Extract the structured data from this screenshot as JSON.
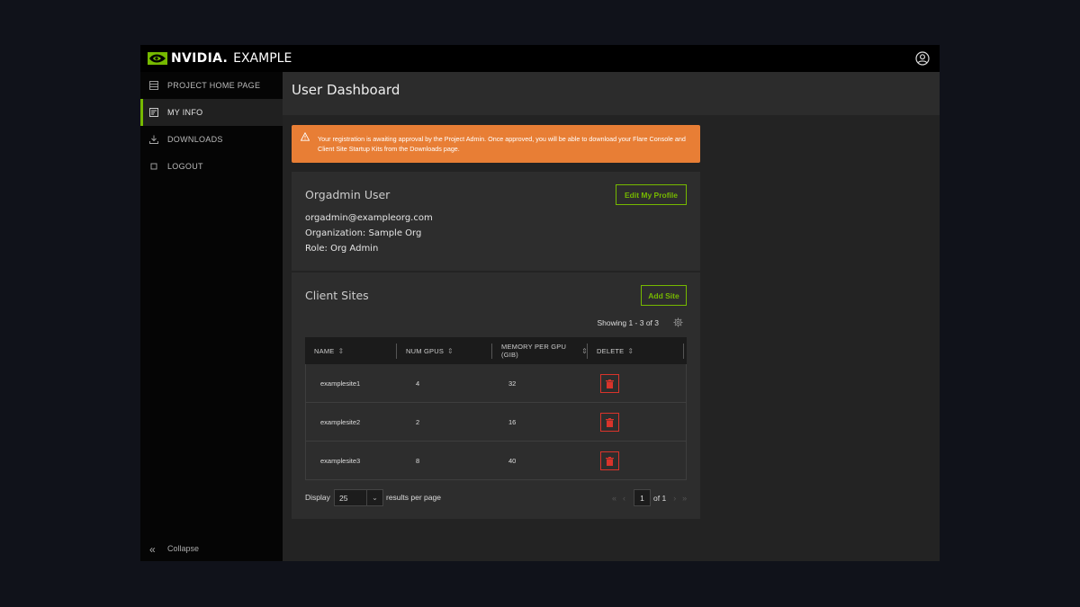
{
  "header": {
    "brand": "NVIDIA.",
    "product": "EXAMPLE",
    "user_icon": "user-circle-icon"
  },
  "sidebar": {
    "items": [
      {
        "label": "PROJECT HOME PAGE",
        "icon": "list-icon",
        "active": false
      },
      {
        "label": "MY INFO",
        "icon": "id-card-icon",
        "active": true
      },
      {
        "label": "DOWNLOADS",
        "icon": "download-icon",
        "active": false
      },
      {
        "label": "LOGOUT",
        "icon": "square-icon",
        "active": false
      }
    ],
    "collapse_label": "Collapse",
    "collapse_icon": "double-chevron-left-icon"
  },
  "page": {
    "title": "User Dashboard"
  },
  "alert": {
    "icon": "warning-icon",
    "text": "Your registration is awaiting approval by the Project Admin. Once approved, you will be able to download your Flare Console and Client Site Startup Kits from the Downloads page.",
    "color": "#e87e35"
  },
  "profile": {
    "name": "Orgadmin User",
    "edit_label": "Edit My Profile",
    "email": "orgadmin@exampleorg.com",
    "organization": "Organization: Sample Org",
    "role": "Role: Org Admin"
  },
  "sites": {
    "title": "Client Sites",
    "add_label": "Add Site",
    "showing": "Showing 1 - 3 of 3",
    "columns": [
      "NAME",
      "NUM GPUS",
      "MEMORY PER GPU (GIB)",
      "DELETE"
    ],
    "rows": [
      {
        "name": "examplesite1",
        "gpus": "4",
        "memory": "32"
      },
      {
        "name": "examplesite2",
        "gpus": "2",
        "memory": "16"
      },
      {
        "name": "examplesite3",
        "gpus": "8",
        "memory": "40"
      }
    ],
    "display_label": "Display",
    "page_size": "25",
    "results_label": "results per page",
    "current_page": "1",
    "of_pages": "of 1"
  },
  "colors": {
    "accent": "#76b900",
    "danger": "#d9342b"
  }
}
